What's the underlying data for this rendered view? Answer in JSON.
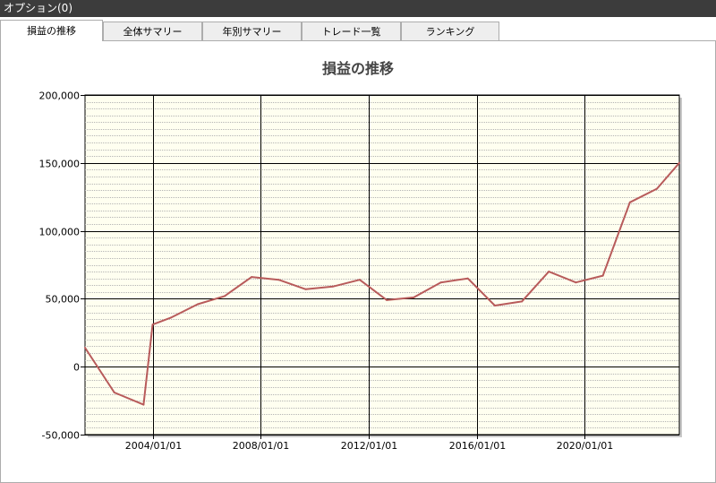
{
  "window": {
    "title": "オプション(0)"
  },
  "tabs": [
    {
      "label": "損益の推移",
      "active": true
    },
    {
      "label": "全体サマリー",
      "active": false
    },
    {
      "label": "年別サマリー",
      "active": false
    },
    {
      "label": "トレード一覧",
      "active": false
    },
    {
      "label": "ランキング",
      "active": false
    }
  ],
  "colors": {
    "plot_background": "#fffff0",
    "line": "#b85b5b",
    "titlebar": "#3c3c3c"
  },
  "chart_data": {
    "type": "line",
    "title": "損益の推移",
    "xlabel": "",
    "ylabel": "",
    "x_type": "date",
    "xlim": [
      "2001-07-01",
      "2023-07-01"
    ],
    "ylim": [
      -50000,
      200000
    ],
    "y_ticks": [
      -50000,
      0,
      50000,
      100000,
      150000,
      200000
    ],
    "y_tick_labels": [
      "-50,000",
      "0",
      "50,000",
      "100,000",
      "150,000",
      "200,000"
    ],
    "x_ticks": [
      "2004-01-01",
      "2008-01-01",
      "2012-01-01",
      "2016-01-01",
      "2020-01-01"
    ],
    "x_tick_labels": [
      "2004/01/01",
      "2008/01/01",
      "2012/01/01",
      "2016/01/01",
      "2020/01/01"
    ],
    "grid": true,
    "legend": "none",
    "series": [
      {
        "x": [
          "2001-07-01",
          "2002-08-01",
          "2003-09-01",
          "2004-01-01",
          "2004-09-01",
          "2005-09-01",
          "2006-09-01",
          "2007-09-01",
          "2008-09-01",
          "2009-09-01",
          "2010-09-01",
          "2011-09-01",
          "2012-09-01",
          "2013-09-01",
          "2014-09-01",
          "2015-09-01",
          "2016-09-01",
          "2017-09-01",
          "2018-09-01",
          "2019-09-01",
          "2020-09-01",
          "2021-09-01",
          "2022-09-01",
          "2023-07-01"
        ],
        "values": [
          14000,
          -19000,
          -28000,
          31000,
          36000,
          46000,
          52000,
          66000,
          64000,
          57000,
          59000,
          64000,
          49000,
          51000,
          62000,
          65000,
          45000,
          48000,
          70000,
          62000,
          67000,
          121000,
          131000,
          150000
        ]
      }
    ]
  }
}
